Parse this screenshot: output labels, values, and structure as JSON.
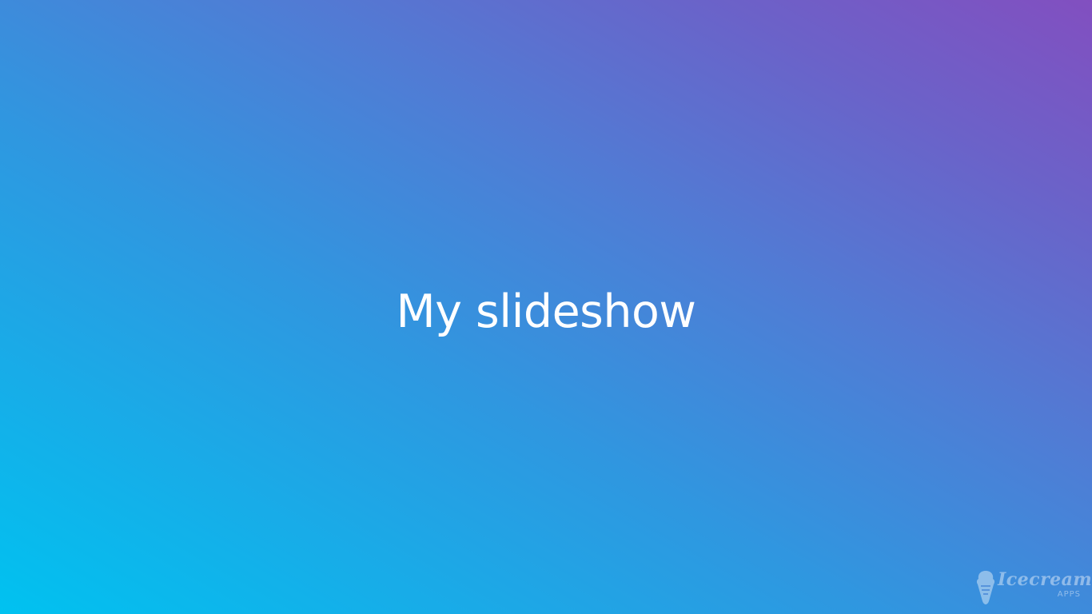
{
  "slide": {
    "title": "My slideshow"
  },
  "watermark": {
    "brand": "Icecream",
    "sub": "APPS"
  },
  "colors": {
    "gradient_start": "#00c2f0",
    "gradient_end": "#824fc0",
    "text": "#ffffff"
  }
}
